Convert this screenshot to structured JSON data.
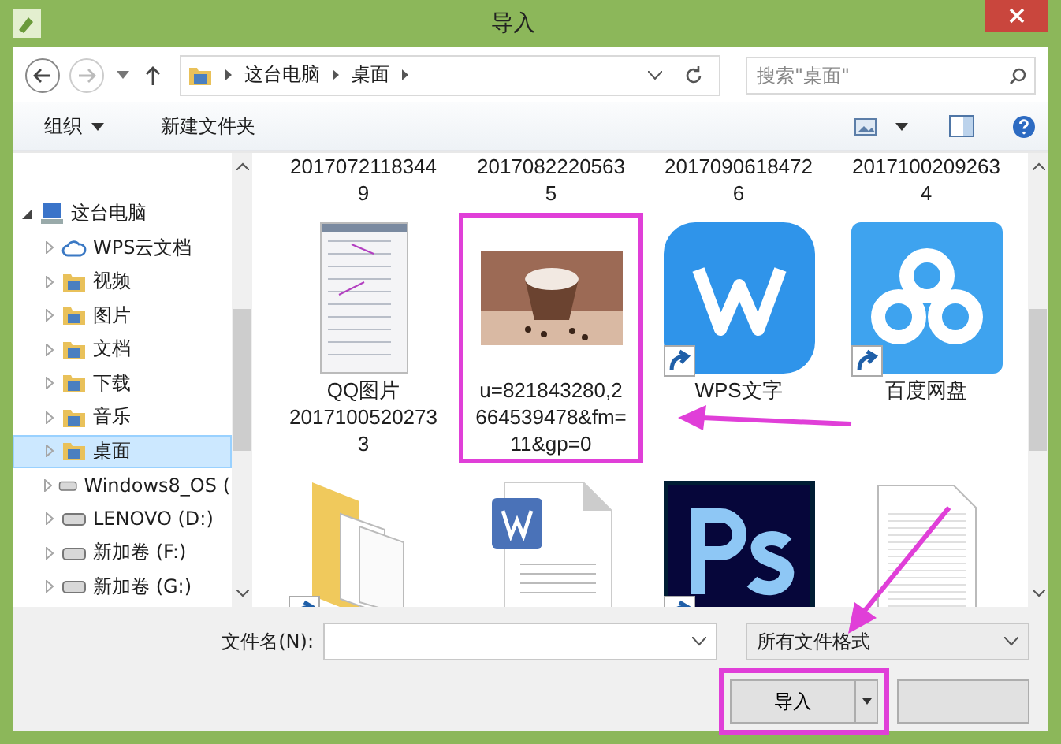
{
  "window": {
    "title": "导入"
  },
  "address": {
    "crumbs": [
      "这台电脑",
      "桌面"
    ],
    "search_placeholder": "搜索\"桌面\""
  },
  "toolbar": {
    "organize": "组织",
    "new_folder": "新建文件夹"
  },
  "nav": [
    {
      "label": "这台电脑",
      "kind": "pc",
      "selected": false,
      "expanded": true,
      "children": [
        {
          "label": "WPS云文档",
          "kind": "cloud",
          "selected": false
        },
        {
          "label": "视频",
          "kind": "folder",
          "selected": false
        },
        {
          "label": "图片",
          "kind": "folder",
          "selected": false
        },
        {
          "label": "文档",
          "kind": "folder",
          "selected": false
        },
        {
          "label": "下载",
          "kind": "folder",
          "selected": false
        },
        {
          "label": "音乐",
          "kind": "folder",
          "selected": false
        },
        {
          "label": "桌面",
          "kind": "folder",
          "selected": true
        },
        {
          "label": "Windows8_OS (",
          "kind": "drive",
          "selected": false
        },
        {
          "label": "LENOVO (D:)",
          "kind": "drive",
          "selected": false
        },
        {
          "label": "新加卷 (F:)",
          "kind": "drive",
          "selected": false
        },
        {
          "label": "新加卷 (G:)",
          "kind": "drive",
          "selected": false
        }
      ]
    }
  ],
  "files": [
    {
      "kind": "label",
      "name": "20170721183449",
      "shortcut": false,
      "highlighted": false
    },
    {
      "kind": "label",
      "name": "20170822205635",
      "shortcut": false,
      "highlighted": false
    },
    {
      "kind": "label",
      "name": "20170906184726",
      "shortcut": false,
      "highlighted": false
    },
    {
      "kind": "label",
      "name": "20171002092634",
      "shortcut": false,
      "highlighted": false
    },
    {
      "kind": "screenshot",
      "name": "QQ图片 20171005202733",
      "shortcut": false,
      "highlighted": false
    },
    {
      "kind": "photo",
      "name": "u=821843280,2664539478&fm=11&gp=0",
      "shortcut": false,
      "highlighted": true
    },
    {
      "kind": "wps-app",
      "name": "WPS文字",
      "shortcut": true,
      "highlighted": false
    },
    {
      "kind": "cloud-app",
      "name": "百度网盘",
      "shortcut": true,
      "highlighted": false
    },
    {
      "kind": "folder",
      "shortcut": true,
      "highlighted": false
    },
    {
      "kind": "wps-doc",
      "shortcut": false,
      "highlighted": false
    },
    {
      "kind": "ps-app",
      "shortcut": true,
      "highlighted": false
    },
    {
      "kind": "text-doc",
      "shortcut": false,
      "highlighted": false
    }
  ],
  "footer": {
    "filename_label": "文件名(N):",
    "filetype": "所有文件格式",
    "open_button": {
      "label": "导入",
      "highlighted": true
    }
  }
}
